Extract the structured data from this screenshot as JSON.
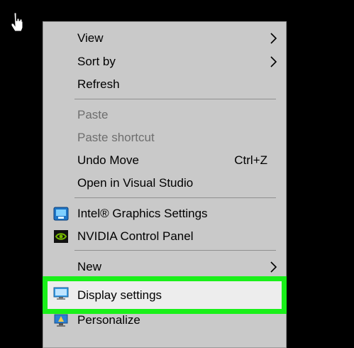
{
  "menu": {
    "items": [
      {
        "label": "View",
        "submenu": true,
        "enabled": true
      },
      {
        "label": "Sort by",
        "submenu": true,
        "enabled": true
      },
      {
        "label": "Refresh",
        "enabled": true
      },
      {
        "label": "Paste",
        "enabled": false
      },
      {
        "label": "Paste shortcut",
        "enabled": false
      },
      {
        "label": "Undo Move",
        "shortcut": "Ctrl+Z",
        "enabled": true
      },
      {
        "label": "Open in Visual Studio",
        "enabled": true
      },
      {
        "label": "Intel® Graphics Settings",
        "icon": "intel-graphics-icon",
        "enabled": true
      },
      {
        "label": "NVIDIA Control Panel",
        "icon": "nvidia-icon",
        "enabled": true
      },
      {
        "label": "New",
        "submenu": true,
        "enabled": true
      },
      {
        "label": "Display settings",
        "icon": "display-icon",
        "enabled": true,
        "highlighted": true
      },
      {
        "label": "Personalize",
        "icon": "personalize-icon",
        "enabled": true
      }
    ]
  },
  "colors": {
    "highlight_border": "#19f019",
    "menu_background": "#c9c9c9",
    "disabled_text": "#6e6e6e"
  }
}
